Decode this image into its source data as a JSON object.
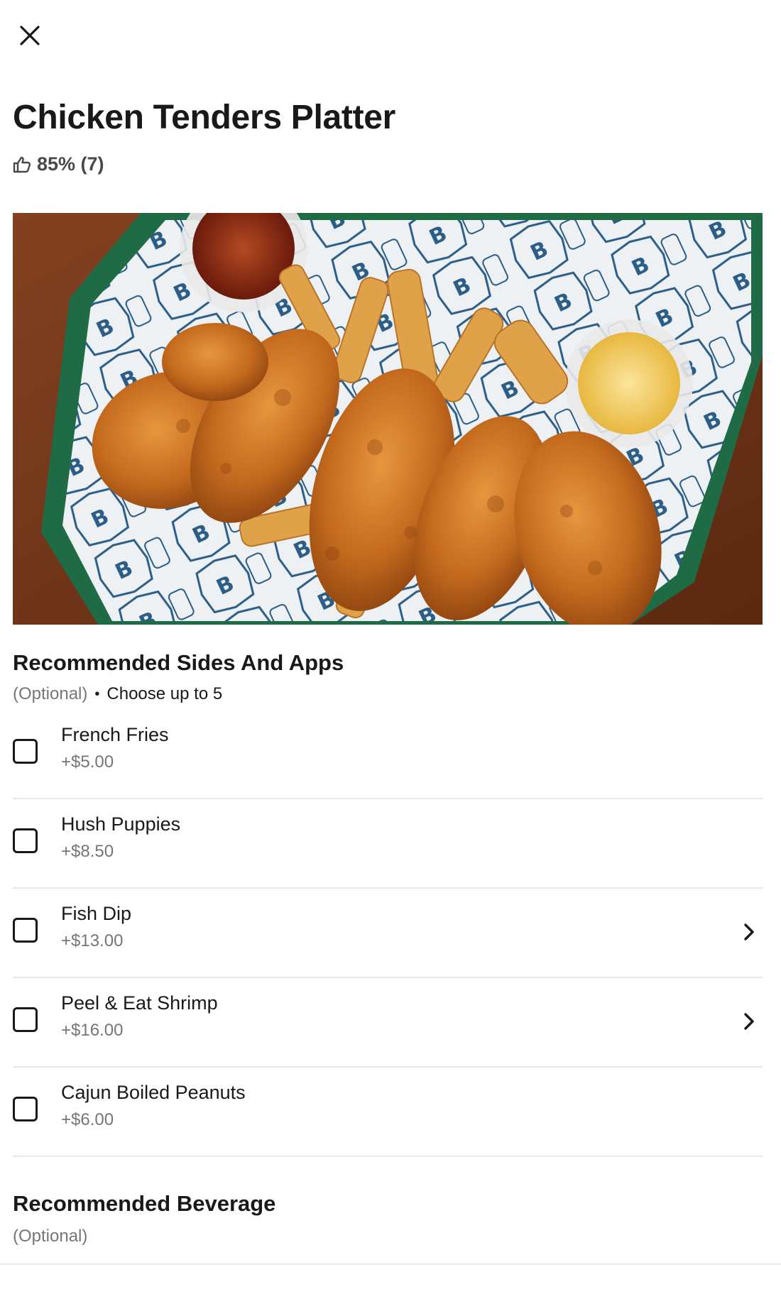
{
  "item": {
    "title": "Chicken Tenders Platter",
    "rating": "85% (7)"
  },
  "sides": {
    "title": "Recommended Sides And Apps",
    "optional": "(Optional)",
    "requirement": "Choose up to 5",
    "options": [
      {
        "name": "French Fries",
        "price": "+$5.00",
        "has_chevron": false
      },
      {
        "name": "Hush Puppies",
        "price": "+$8.50",
        "has_chevron": false
      },
      {
        "name": "Fish Dip",
        "price": "+$13.00",
        "has_chevron": true
      },
      {
        "name": "Peel & Eat Shrimp",
        "price": "+$16.00",
        "has_chevron": true
      },
      {
        "name": "Cajun Boiled Peanuts",
        "price": "+$6.00",
        "has_chevron": false
      }
    ]
  },
  "beverage": {
    "title": "Recommended Beverage",
    "optional": "(Optional)"
  },
  "icons": {
    "close": "close-icon",
    "rating": "thumbs-up-icon",
    "chevron": "chevron-right-icon"
  }
}
